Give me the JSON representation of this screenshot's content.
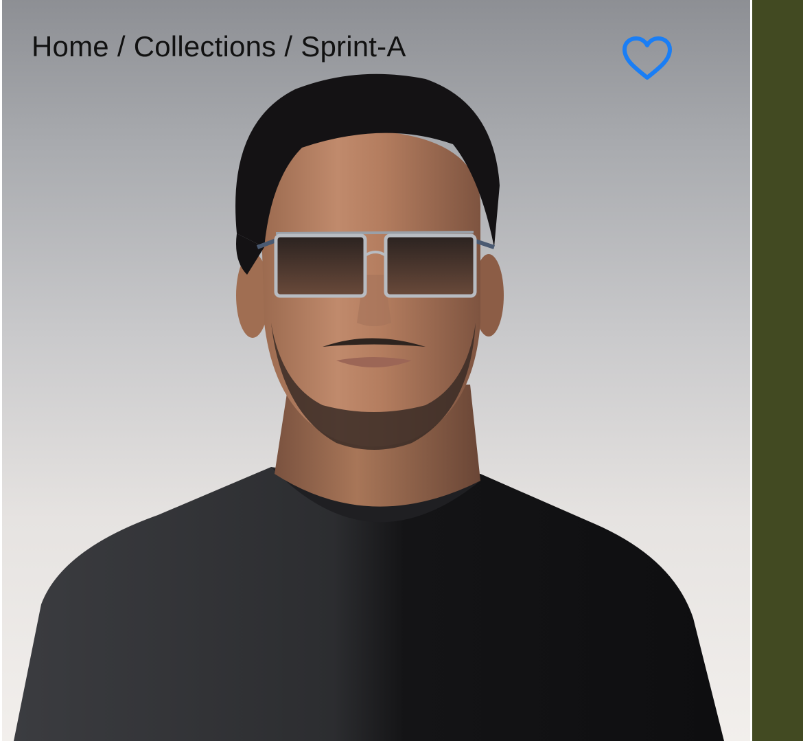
{
  "breadcrumb": {
    "home": "Home",
    "collections": "Collections",
    "current": "Sprint-A",
    "separator": "/"
  },
  "favorite": {
    "icon": "heart-outline-icon",
    "color": "#1a7ef5"
  },
  "hero": {
    "image": "portrait of a man wearing rectangular sunglasses and a black t-shirt"
  },
  "colors": {
    "side_panel": "#424a22",
    "breadcrumb_text": "#111111",
    "accent": "#1a7ef5"
  }
}
